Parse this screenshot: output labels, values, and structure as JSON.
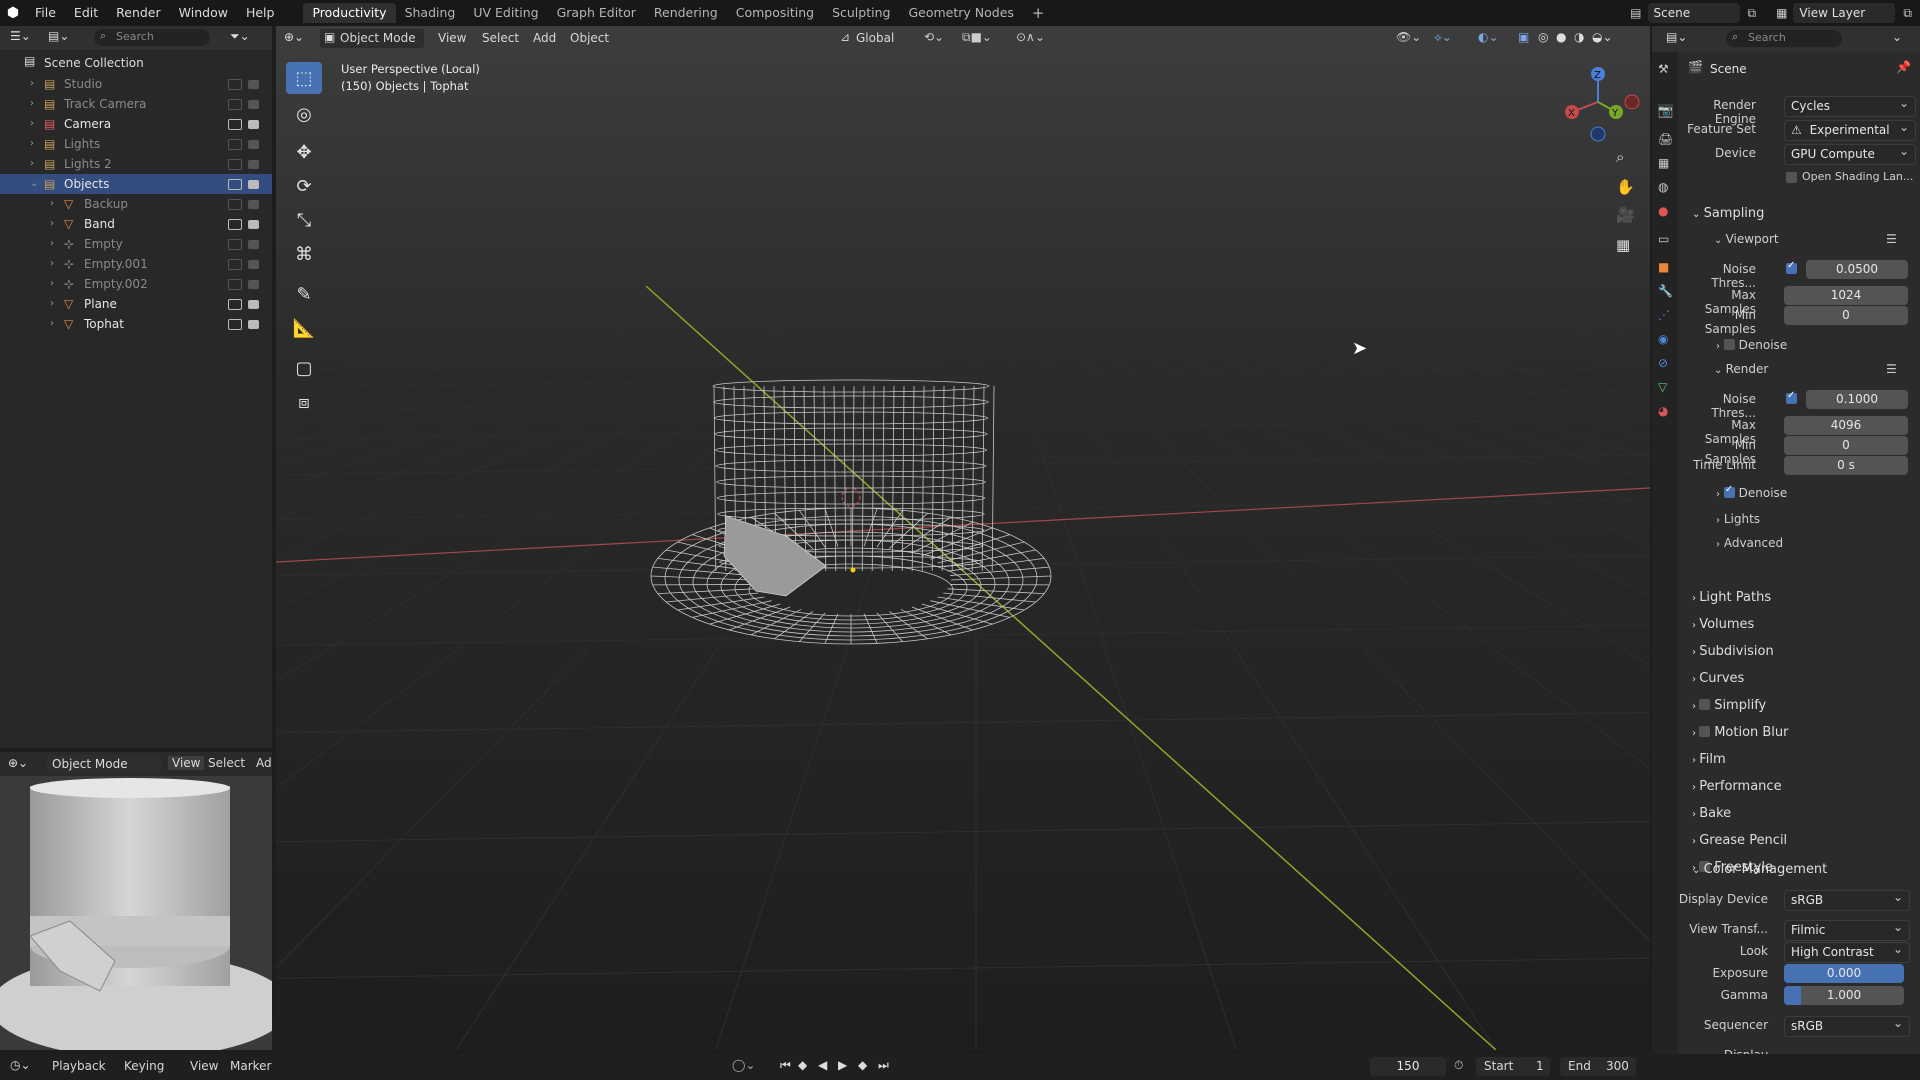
{
  "topbar": {
    "menus": [
      "File",
      "Edit",
      "Render",
      "Window",
      "Help"
    ],
    "workspaces": [
      "Productivity",
      "Shading",
      "UV Editing",
      "Graph Editor",
      "Rendering",
      "Compositing",
      "Sculpting",
      "Geometry Nodes"
    ],
    "active_workspace": "Productivity",
    "scene_label": "Scene",
    "view_layer_label": "View Layer"
  },
  "outliner": {
    "search_placeholder": "Search",
    "root": "Scene Collection",
    "rows": [
      {
        "label": "Studio",
        "kind": "collection",
        "visible": false
      },
      {
        "label": "Track Camera",
        "kind": "collection",
        "visible": false
      },
      {
        "label": "Camera",
        "kind": "collection",
        "visible": true
      },
      {
        "label": "Lights",
        "kind": "collection",
        "visible": false
      },
      {
        "label": "Lights 2",
        "kind": "collection",
        "visible": false
      },
      {
        "label": "Objects",
        "kind": "collection",
        "visible": true
      },
      {
        "label": "Backup",
        "kind": "object",
        "visible": false
      },
      {
        "label": "Band",
        "kind": "object",
        "visible": true
      },
      {
        "label": "Empty",
        "kind": "empty",
        "visible": false
      },
      {
        "label": "Empty.001",
        "kind": "empty",
        "visible": false
      },
      {
        "label": "Empty.002",
        "kind": "empty",
        "visible": false
      },
      {
        "label": "Plane",
        "kind": "object",
        "visible": true
      },
      {
        "label": "Tophat",
        "kind": "object",
        "visible": true
      }
    ]
  },
  "mini_view": {
    "mode": "Object Mode",
    "menus": [
      "View",
      "Select",
      "Ad"
    ]
  },
  "viewport": {
    "mode": "Object Mode",
    "menus": [
      "View",
      "Select",
      "Add",
      "Object"
    ],
    "orientation": "Global",
    "info_line1": "User Perspective (Local)",
    "info_line2": "(150) Objects | Tophat",
    "gizmo_axes": [
      "X",
      "Y",
      "Z"
    ]
  },
  "properties": {
    "search_placeholder": "Search",
    "title": "Scene",
    "render_engine_label": "Render Engine",
    "render_engine": "Cycles",
    "feature_set_label": "Feature Set",
    "feature_set": "Experimental",
    "device_label": "Device",
    "device": "GPU Compute",
    "osl_label": "Open Shading Lan...",
    "sampling": "Sampling",
    "viewport": "Viewport",
    "noise_label": "Noise Thres...",
    "vp_noise": "0.0500",
    "max_samples_label": "Max Samples",
    "vp_max": "1024",
    "min_samples_label": "Min Samples",
    "vp_min": "0",
    "denoise": "Denoise",
    "render": "Render",
    "r_noise": "0.1000",
    "r_max": "4096",
    "r_min": "0",
    "time_limit_label": "Time Limit",
    "time_limit": "0 s",
    "lights": "Lights",
    "advanced": "Advanced",
    "panels": [
      "Light Paths",
      "Volumes",
      "Subdivision",
      "Curves",
      "Simplify",
      "Motion Blur",
      "Film",
      "Performance",
      "Bake",
      "Grease Pencil",
      "Freestyle"
    ],
    "color_management": "Color Management",
    "display_device_label": "Display Device",
    "display_device": "sRGB",
    "view_transform_label": "View Transf...",
    "view_transform": "Filmic",
    "look_label": "Look",
    "look": "High Contrast",
    "exposure_label": "Exposure",
    "exposure": "0.000",
    "gamma_label": "Gamma",
    "gamma": "1.000",
    "sequencer_label": "Sequencer",
    "sequencer": "sRGB",
    "display": "Display"
  },
  "timeline": {
    "menus": [
      "Playback",
      "Keying",
      "View",
      "Marker"
    ],
    "current_frame": "150",
    "start_label": "Start",
    "start": "1",
    "end_label": "End",
    "end": "300"
  }
}
